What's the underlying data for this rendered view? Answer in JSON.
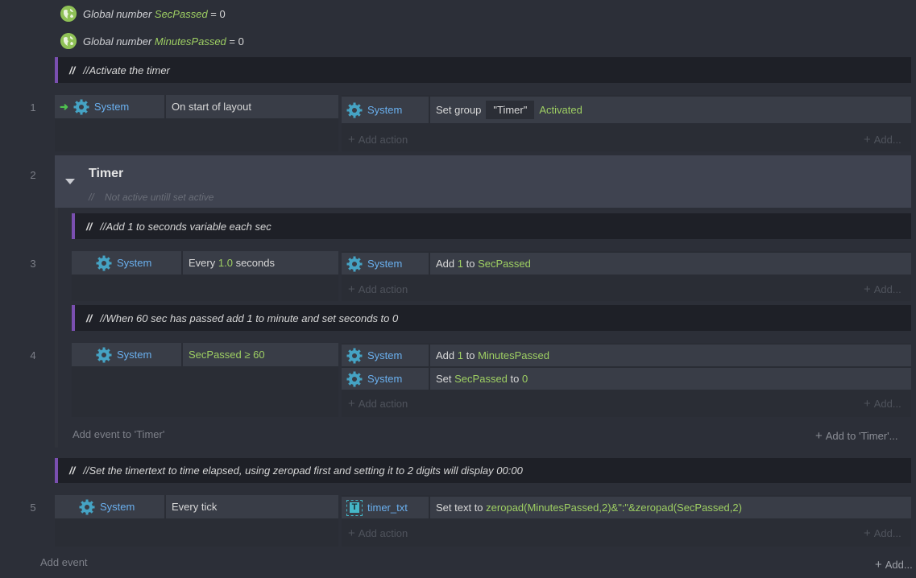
{
  "globals": [
    {
      "kind": "Global number",
      "name": "SecPassed",
      "value": "= 0"
    },
    {
      "kind": "Global number",
      "name": "MinutesPassed",
      "value": "= 0"
    }
  ],
  "comments": {
    "activate": "//Activate the timer",
    "add_sec": "//Add 1 to seconds variable each sec",
    "when60": "//When 60 sec has passed add 1 to minute and set seconds to 0",
    "timertext": "//Set the timertext to time elapsed, using zeropad first and setting it to 2 digits will display 00:00"
  },
  "comment_prefix": "//",
  "events": {
    "e1": {
      "num": "1",
      "cond_obj": "System",
      "cond_text": "On start of layout",
      "act_obj": "System",
      "act_pre": "Set group",
      "act_param": "\"Timer\"",
      "act_post": "Activated"
    },
    "e2": {
      "num": "2",
      "group_title": "Timer",
      "group_desc_prefix": "//",
      "group_desc": "Not active untill set active"
    },
    "e3": {
      "num": "3",
      "cond_obj": "System",
      "cond_pre": "Every",
      "cond_val": "1.0",
      "cond_post": "seconds",
      "act_obj": "System",
      "act_pre": "Add",
      "act_val": "1",
      "act_mid": "to",
      "act_var": "SecPassed"
    },
    "e4": {
      "num": "4",
      "cond_obj": "System",
      "cond_text": "SecPassed ≥ 60",
      "act1_obj": "System",
      "act1_pre": "Add",
      "act1_val": "1",
      "act1_mid": "to",
      "act1_var": "MinutesPassed",
      "act2_obj": "System",
      "act2_pre": "Set",
      "act2_var": "SecPassed",
      "act2_mid": "to",
      "act2_val": "0"
    },
    "e5": {
      "num": "5",
      "cond_obj": "System",
      "cond_text": "Every tick",
      "act_obj": "timer_txt",
      "act_pre": "Set text to",
      "act_expr": "zeropad(MinutesPassed,2)&\":\"&zeropad(SecPassed,2)"
    }
  },
  "labels": {
    "add_action": "Add action",
    "add_short": "Add...",
    "add_event_to_group": "Add event to 'Timer'",
    "add_to_group": "Add to 'Timer'...",
    "add_event": "Add event",
    "add_long": "Add..."
  },
  "colors": {
    "accent_comment": "#7a4fb0",
    "green": "#9ecf63",
    "blue": "#6ab0ef",
    "gear": "#45a3c4"
  }
}
